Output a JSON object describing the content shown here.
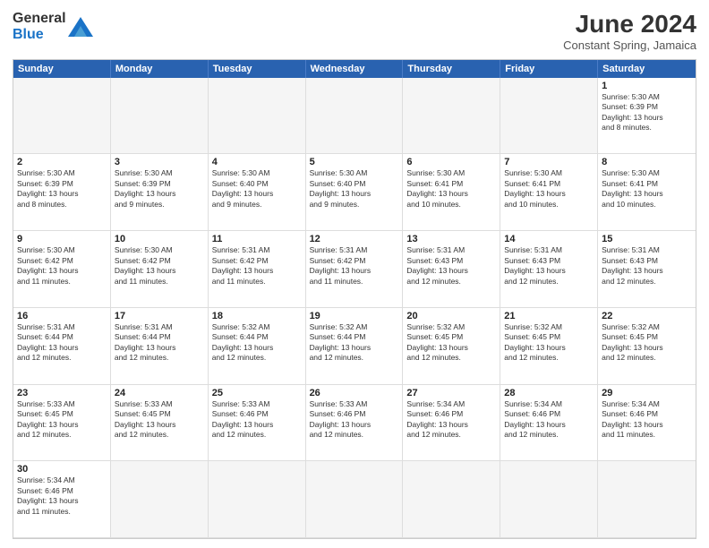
{
  "header": {
    "logo_general": "General",
    "logo_blue": "Blue",
    "month": "June 2024",
    "location": "Constant Spring, Jamaica"
  },
  "day_headers": [
    "Sunday",
    "Monday",
    "Tuesday",
    "Wednesday",
    "Thursday",
    "Friday",
    "Saturday"
  ],
  "cells": [
    {
      "day": "",
      "empty": true,
      "info": ""
    },
    {
      "day": "",
      "empty": true,
      "info": ""
    },
    {
      "day": "",
      "empty": true,
      "info": ""
    },
    {
      "day": "",
      "empty": true,
      "info": ""
    },
    {
      "day": "",
      "empty": true,
      "info": ""
    },
    {
      "day": "",
      "empty": true,
      "info": ""
    },
    {
      "day": "1",
      "info": "Sunrise: 5:30 AM\nSunset: 6:39 PM\nDaylight: 13 hours\nand 8 minutes."
    },
    {
      "day": "2",
      "info": "Sunrise: 5:30 AM\nSunset: 6:39 PM\nDaylight: 13 hours\nand 8 minutes."
    },
    {
      "day": "3",
      "info": "Sunrise: 5:30 AM\nSunset: 6:39 PM\nDaylight: 13 hours\nand 9 minutes."
    },
    {
      "day": "4",
      "info": "Sunrise: 5:30 AM\nSunset: 6:40 PM\nDaylight: 13 hours\nand 9 minutes."
    },
    {
      "day": "5",
      "info": "Sunrise: 5:30 AM\nSunset: 6:40 PM\nDaylight: 13 hours\nand 9 minutes."
    },
    {
      "day": "6",
      "info": "Sunrise: 5:30 AM\nSunset: 6:41 PM\nDaylight: 13 hours\nand 10 minutes."
    },
    {
      "day": "7",
      "info": "Sunrise: 5:30 AM\nSunset: 6:41 PM\nDaylight: 13 hours\nand 10 minutes."
    },
    {
      "day": "8",
      "info": "Sunrise: 5:30 AM\nSunset: 6:41 PM\nDaylight: 13 hours\nand 10 minutes."
    },
    {
      "day": "9",
      "info": "Sunrise: 5:30 AM\nSunset: 6:42 PM\nDaylight: 13 hours\nand 11 minutes."
    },
    {
      "day": "10",
      "info": "Sunrise: 5:30 AM\nSunset: 6:42 PM\nDaylight: 13 hours\nand 11 minutes."
    },
    {
      "day": "11",
      "info": "Sunrise: 5:31 AM\nSunset: 6:42 PM\nDaylight: 13 hours\nand 11 minutes."
    },
    {
      "day": "12",
      "info": "Sunrise: 5:31 AM\nSunset: 6:42 PM\nDaylight: 13 hours\nand 11 minutes."
    },
    {
      "day": "13",
      "info": "Sunrise: 5:31 AM\nSunset: 6:43 PM\nDaylight: 13 hours\nand 12 minutes."
    },
    {
      "day": "14",
      "info": "Sunrise: 5:31 AM\nSunset: 6:43 PM\nDaylight: 13 hours\nand 12 minutes."
    },
    {
      "day": "15",
      "info": "Sunrise: 5:31 AM\nSunset: 6:43 PM\nDaylight: 13 hours\nand 12 minutes."
    },
    {
      "day": "16",
      "info": "Sunrise: 5:31 AM\nSunset: 6:44 PM\nDaylight: 13 hours\nand 12 minutes."
    },
    {
      "day": "17",
      "info": "Sunrise: 5:31 AM\nSunset: 6:44 PM\nDaylight: 13 hours\nand 12 minutes."
    },
    {
      "day": "18",
      "info": "Sunrise: 5:32 AM\nSunset: 6:44 PM\nDaylight: 13 hours\nand 12 minutes."
    },
    {
      "day": "19",
      "info": "Sunrise: 5:32 AM\nSunset: 6:44 PM\nDaylight: 13 hours\nand 12 minutes."
    },
    {
      "day": "20",
      "info": "Sunrise: 5:32 AM\nSunset: 6:45 PM\nDaylight: 13 hours\nand 12 minutes."
    },
    {
      "day": "21",
      "info": "Sunrise: 5:32 AM\nSunset: 6:45 PM\nDaylight: 13 hours\nand 12 minutes."
    },
    {
      "day": "22",
      "info": "Sunrise: 5:32 AM\nSunset: 6:45 PM\nDaylight: 13 hours\nand 12 minutes."
    },
    {
      "day": "23",
      "info": "Sunrise: 5:33 AM\nSunset: 6:45 PM\nDaylight: 13 hours\nand 12 minutes."
    },
    {
      "day": "24",
      "info": "Sunrise: 5:33 AM\nSunset: 6:45 PM\nDaylight: 13 hours\nand 12 minutes."
    },
    {
      "day": "25",
      "info": "Sunrise: 5:33 AM\nSunset: 6:46 PM\nDaylight: 13 hours\nand 12 minutes."
    },
    {
      "day": "26",
      "info": "Sunrise: 5:33 AM\nSunset: 6:46 PM\nDaylight: 13 hours\nand 12 minutes."
    },
    {
      "day": "27",
      "info": "Sunrise: 5:34 AM\nSunset: 6:46 PM\nDaylight: 13 hours\nand 12 minutes."
    },
    {
      "day": "28",
      "info": "Sunrise: 5:34 AM\nSunset: 6:46 PM\nDaylight: 13 hours\nand 12 minutes."
    },
    {
      "day": "29",
      "info": "Sunrise: 5:34 AM\nSunset: 6:46 PM\nDaylight: 13 hours\nand 11 minutes."
    },
    {
      "day": "30",
      "info": "Sunrise: 5:34 AM\nSunset: 6:46 PM\nDaylight: 13 hours\nand 11 minutes."
    },
    {
      "day": "",
      "empty": true,
      "info": ""
    },
    {
      "day": "",
      "empty": true,
      "info": ""
    },
    {
      "day": "",
      "empty": true,
      "info": ""
    },
    {
      "day": "",
      "empty": true,
      "info": ""
    },
    {
      "day": "",
      "empty": true,
      "info": ""
    },
    {
      "day": "",
      "empty": true,
      "info": ""
    }
  ]
}
